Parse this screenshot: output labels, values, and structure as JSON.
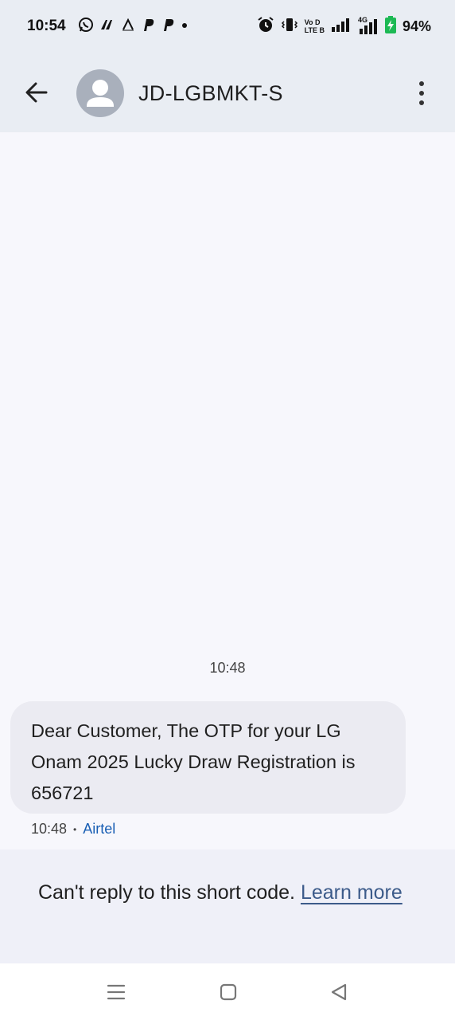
{
  "status_bar": {
    "time": "10:54",
    "battery_percent": "94%",
    "volte_label_top": "Vo D",
    "volte_label_bottom": "LTE B",
    "network_type": "4G"
  },
  "header": {
    "contact_name": "JD-LGBMKT-S"
  },
  "conversation": {
    "timestamp": "10:48",
    "message": {
      "text": "Dear Customer, The OTP for your LG Onam 2025 Lucky Draw Registration is 656721",
      "time": "10:48",
      "separator": "•",
      "sim": "Airtel"
    }
  },
  "reply_notice": {
    "text": "Can't reply to this short code. ",
    "link": "Learn more"
  },
  "colors": {
    "app_bar_bg": "#e9edf3",
    "bubble_bg": "#ebebf2",
    "link": "#3c5b8a",
    "battery_green": "#1db954"
  }
}
